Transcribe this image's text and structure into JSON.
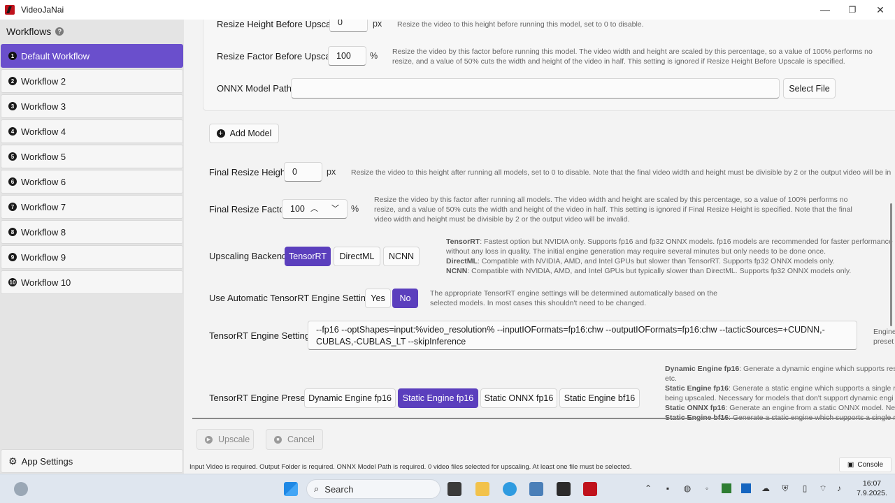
{
  "window": {
    "title": "VideoJaNai",
    "minimize": "—",
    "maximize": "❐",
    "close": "✕"
  },
  "sidebar": {
    "header": "Workflows",
    "help": "?",
    "items": [
      {
        "num": "1",
        "label": "Default Workflow"
      },
      {
        "num": "2",
        "label": "Workflow 2"
      },
      {
        "num": "3",
        "label": "Workflow 3"
      },
      {
        "num": "4",
        "label": "Workflow 4"
      },
      {
        "num": "5",
        "label": "Workflow 5"
      },
      {
        "num": "6",
        "label": "Workflow 6"
      },
      {
        "num": "7",
        "label": "Workflow 7"
      },
      {
        "num": "8",
        "label": "Workflow 8"
      },
      {
        "num": "9",
        "label": "Workflow 9"
      },
      {
        "num": "10",
        "label": "Workflow 10"
      }
    ],
    "app_settings": "App Settings"
  },
  "model": {
    "resize_height_label": "Resize Height Before Upscale",
    "resize_height_value": "0",
    "resize_height_unit": "px",
    "resize_height_desc": "Resize the video to this height before running this model, set to 0 to disable.",
    "resize_factor_label": "Resize Factor Before Upscale",
    "resize_factor_value": "100",
    "resize_factor_unit": "%",
    "resize_factor_desc": "Resize the video by this factor before running this model. The video width and height are scaled by this percentage, so a value of 100% performs no resize, and a value of 50% cuts the width and height of the video in half. This setting is ignored if Resize Height Before Upscale is specified.",
    "onnx_label": "ONNX Model Path",
    "onnx_value": "",
    "select_file": "Select File"
  },
  "add_model": "Add Model",
  "final_resize_height": {
    "label": "Final Resize Height",
    "value": "0",
    "unit": "px",
    "desc": "Resize the video to this height after running all models, set to 0 to disable. Note that the final video width and height must be divisible by 2 or the output video will be in"
  },
  "final_resize_factor": {
    "label": "Final Resize Factor",
    "value": "100",
    "unit": "%",
    "desc": "Resize the video by this factor after running all models. The video width and height are scaled by this percentage, so a value of 100% performs no resize, and a value of 50% cuts the width and height of the video in half. This setting is ignored if Final Resize Height is specified. Note that the final video width and height must be divisible by 2 or the output video will be invalid."
  },
  "backend": {
    "label": "Upscaling Backend",
    "options": [
      "TensorRT",
      "DirectML",
      "NCNN"
    ],
    "selected": "TensorRT",
    "desc": [
      {
        "name": "TensorRT",
        "text": ": Fastest option but NVIDIA only. Supports fp16 and fp32 ONNX models. fp16 models are recommended for faster performance an"
      },
      {
        "name": "",
        "text": "without any loss in quality. The initial engine generation may require several minutes but only needs to be done once."
      },
      {
        "name": "DirectML",
        "text": ": Compatible with NVIDIA, AMD, and Intel GPUs but slower than TensorRT. Supports fp32 ONNX models only."
      },
      {
        "name": "NCNN",
        "text": ": Compatible with NVIDIA, AMD, and Intel GPUs but typically slower than DirectML. Supports fp32 ONNX models only."
      }
    ]
  },
  "auto_trt": {
    "label": "Use Automatic TensorRT Engine Settings",
    "yes": "Yes",
    "no": "No",
    "selected": "No",
    "desc": "The appropriate TensorRT engine settings will be determined automatically based on the selected models. In most cases this shouldn't need to be changed."
  },
  "trt_settings": {
    "label": "TensorRT Engine Settings",
    "value": "--fp16 --optShapes=input:%video_resolution% --inputIOFormats=fp16:chw --outputIOFormats=fp16:chw --tacticSources=+CUDNN,-CUBLAS,-CUBLAS_LT --skipInference",
    "side_note_1": "Engine",
    "side_note_2": "preset"
  },
  "trt_presets": {
    "label": "TensorRT Engine Presets",
    "options": [
      "Dynamic Engine fp16",
      "Static Engine fp16",
      "Static ONNX fp16",
      "Static Engine bf16"
    ],
    "selected": "Static Engine fp16",
    "desc": [
      {
        "name": "Dynamic Engine fp16",
        "text": ": Generate a dynamic engine which supports resolu"
      },
      {
        "name": "",
        "text": "etc."
      },
      {
        "name": "Static Engine fp16",
        "text": ": Generate a static engine which supports a single res"
      },
      {
        "name": "",
        "text": "being upscaled. Necessary for models that don't support dynamic engi"
      },
      {
        "name": "Static ONNX fp16",
        "text": ": Generate an engine from a static ONNX model. Nece"
      },
      {
        "name": "Static Engine bf16",
        "text": ": Generate a static engine which supports a single res"
      }
    ]
  },
  "footer": {
    "upscale": "Upscale",
    "cancel": "Cancel",
    "status": "Input Video is required. Output Folder is required. ONNX Model Path is required. 0 video files selected for upscaling. At least one file must be selected.",
    "console": "Console"
  },
  "taskbar": {
    "search_placeholder": "Search",
    "time": "16:07",
    "date": "7.9.2025."
  },
  "colors": {
    "accent": "#5b3fbd",
    "sidebar_active": "#6a4fcc",
    "sidebar_bg": "#e4e4e4",
    "taskbar_bg": "#dfe6ef"
  }
}
